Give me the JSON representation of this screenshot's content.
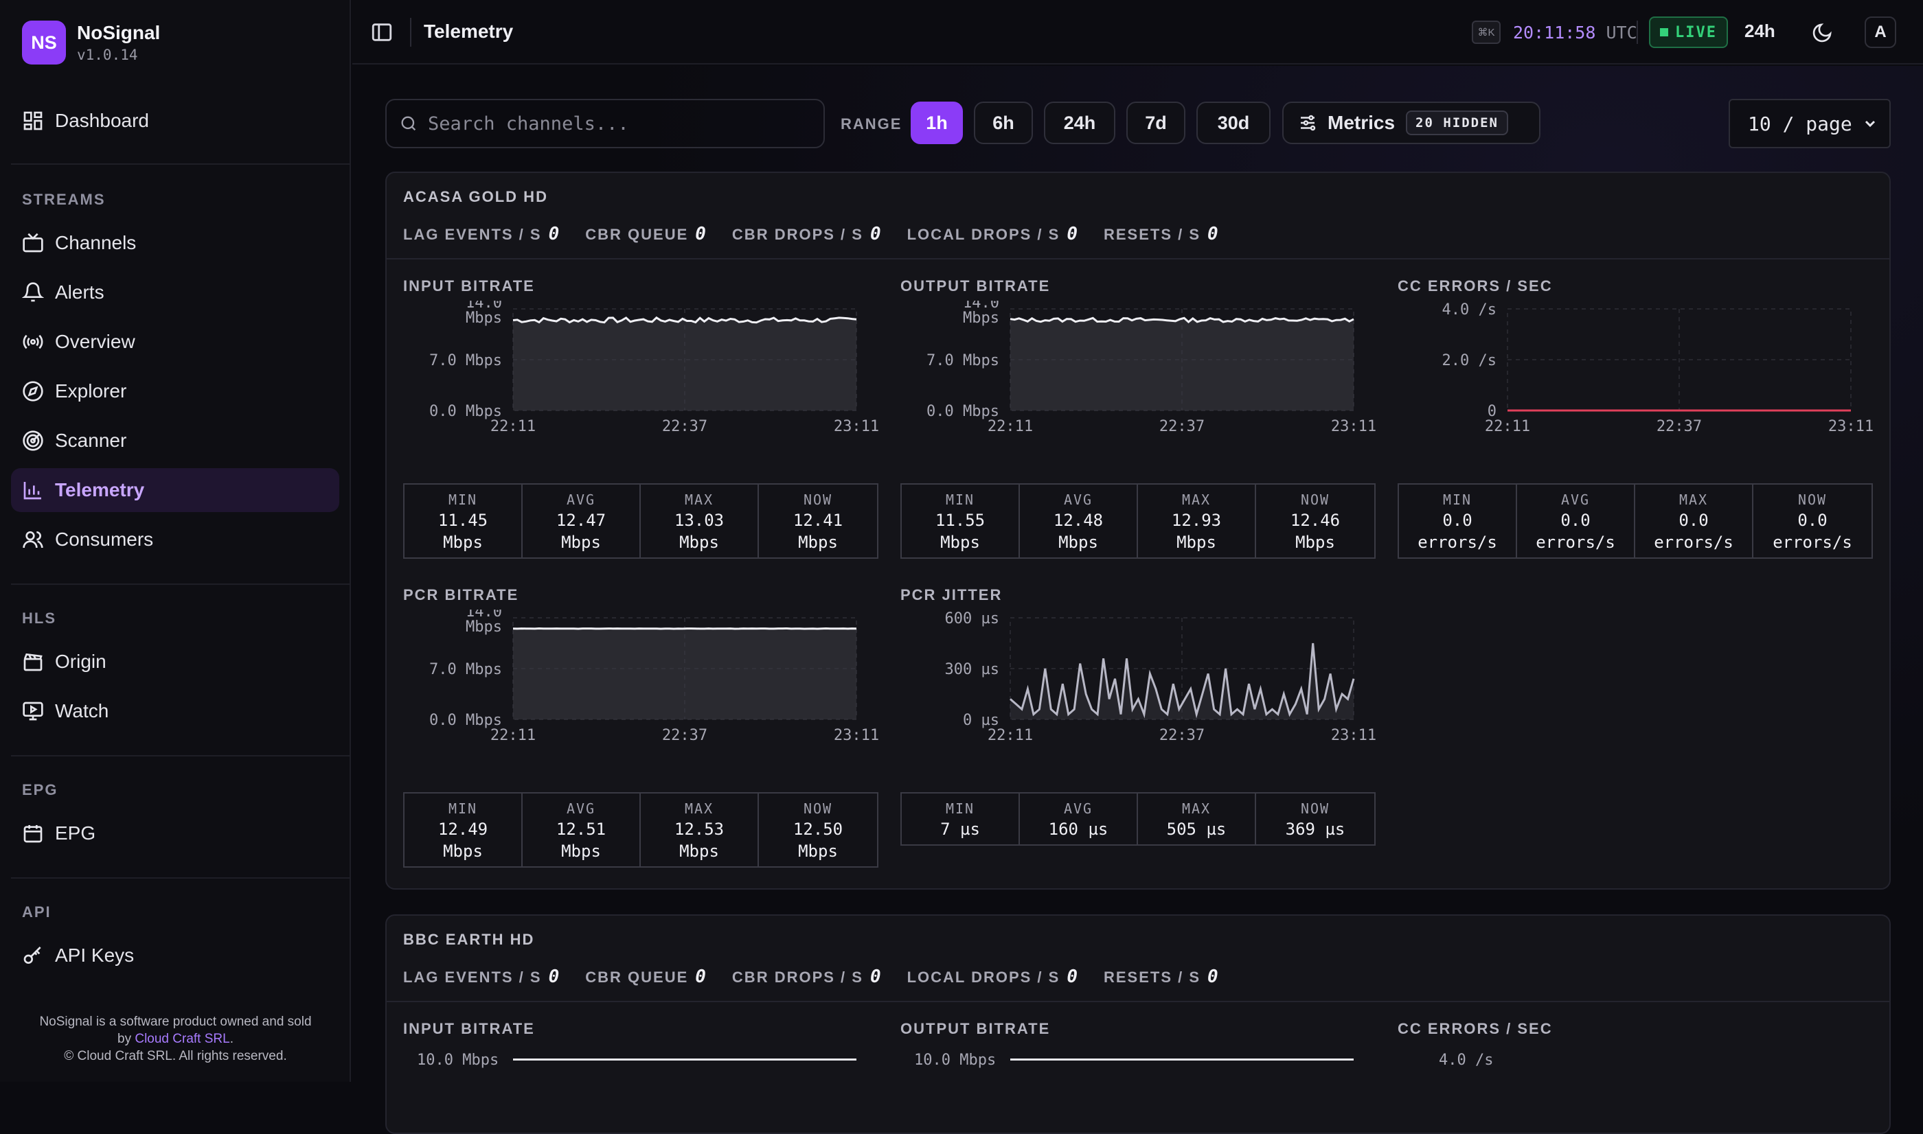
{
  "brand": {
    "logo": "NS",
    "name": "NoSignal",
    "version": "v1.0.14"
  },
  "nav": {
    "dashboard": "Dashboard",
    "sections": {
      "streams": "STREAMS",
      "hls": "HLS",
      "epg": "EPG",
      "api": "API"
    },
    "channels": "Channels",
    "alerts": "Alerts",
    "overview": "Overview",
    "explorer": "Explorer",
    "scanner": "Scanner",
    "telemetry": "Telemetry",
    "consumers": "Consumers",
    "origin": "Origin",
    "watch": "Watch",
    "epg": "EPG",
    "api_keys": "API Keys"
  },
  "footer": {
    "line1": "NoSignal is a software product owned and sold",
    "by": "by ",
    "company": "Cloud Craft SRL",
    "dot": ".",
    "line3": "© Cloud Craft SRL. All rights reserved."
  },
  "topbar": {
    "title": "Telemetry",
    "kbd": "⌘K",
    "time": "20:11:58",
    "tz": "UTC",
    "live": "LIVE",
    "range": "24h",
    "avatar": "A"
  },
  "toolbar": {
    "search_placeholder": "Search channels...",
    "range_label": "RANGE",
    "ranges": [
      "1h",
      "6h",
      "24h",
      "7d",
      "30d"
    ],
    "active_range": "1h",
    "metrics_label": "Metrics",
    "hidden_badge": "20 HIDDEN",
    "page_size": "10 / page"
  },
  "counter_labels": [
    "LAG EVENTS / S",
    "CBR QUEUE",
    "CBR DROPS / S",
    "LOCAL DROPS / S",
    "RESETS / S"
  ],
  "stat_labels": [
    "MIN",
    "AVG",
    "MAX",
    "NOW"
  ],
  "x_ticks": [
    "22:11",
    "22:37",
    "23:11"
  ],
  "accent_color": "#8b3cf7",
  "channels": [
    {
      "name": "ACASA GOLD HD",
      "counters": [
        "0",
        "0",
        "0",
        "0",
        "0"
      ],
      "panels": [
        {
          "title": "INPUT BITRATE",
          "y_ticks": [
            "14.0 Mbps",
            "7.0 Mbps",
            "0.0 Mbps"
          ],
          "ymax": 14,
          "stats": [
            [
              "11.45",
              "Mbps"
            ],
            [
              "12.47",
              "Mbps"
            ],
            [
              "13.03",
              "Mbps"
            ],
            [
              "12.41",
              "Mbps"
            ]
          ]
        },
        {
          "title": "OUTPUT BITRATE",
          "y_ticks": [
            "14.0 Mbps",
            "7.0 Mbps",
            "0.0 Mbps"
          ],
          "ymax": 14,
          "stats": [
            [
              "11.55",
              "Mbps"
            ],
            [
              "12.48",
              "Mbps"
            ],
            [
              "12.93",
              "Mbps"
            ],
            [
              "12.46",
              "Mbps"
            ]
          ]
        },
        {
          "title": "CC ERRORS / SEC",
          "y_ticks": [
            "4.0 /s",
            "2.0 /s",
            "0"
          ],
          "ymax": 4,
          "stats": [
            [
              "0.0",
              "errors/s"
            ],
            [
              "0.0",
              "errors/s"
            ],
            [
              "0.0",
              "errors/s"
            ],
            [
              "0.0",
              "errors/s"
            ]
          ]
        },
        {
          "title": "PCR BITRATE",
          "y_ticks": [
            "14.0 Mbps",
            "7.0 Mbps",
            "0.0 Mbps"
          ],
          "ymax": 14,
          "stats": [
            [
              "12.49",
              "Mbps"
            ],
            [
              "12.51",
              "Mbps"
            ],
            [
              "12.53",
              "Mbps"
            ],
            [
              "12.50",
              "Mbps"
            ]
          ]
        },
        {
          "title": "PCR JITTER",
          "y_ticks": [
            "600 µs",
            "300 µs",
            "0 µs"
          ],
          "ymax": 600,
          "stats": [
            [
              "7 µs",
              ""
            ],
            [
              "160 µs",
              ""
            ],
            [
              "505 µs",
              ""
            ],
            [
              "369 µs",
              ""
            ]
          ]
        }
      ]
    },
    {
      "name": "BBC EARTH HD",
      "counters": [
        "0",
        "0",
        "0",
        "0",
        "0"
      ],
      "panels": [
        {
          "title": "INPUT BITRATE",
          "y_top": "10.0 Mbps"
        },
        {
          "title": "OUTPUT BITRATE",
          "y_top": "10.0 Mbps"
        },
        {
          "title": "CC ERRORS / SEC",
          "y_top": "4.0 /s"
        }
      ]
    }
  ]
}
